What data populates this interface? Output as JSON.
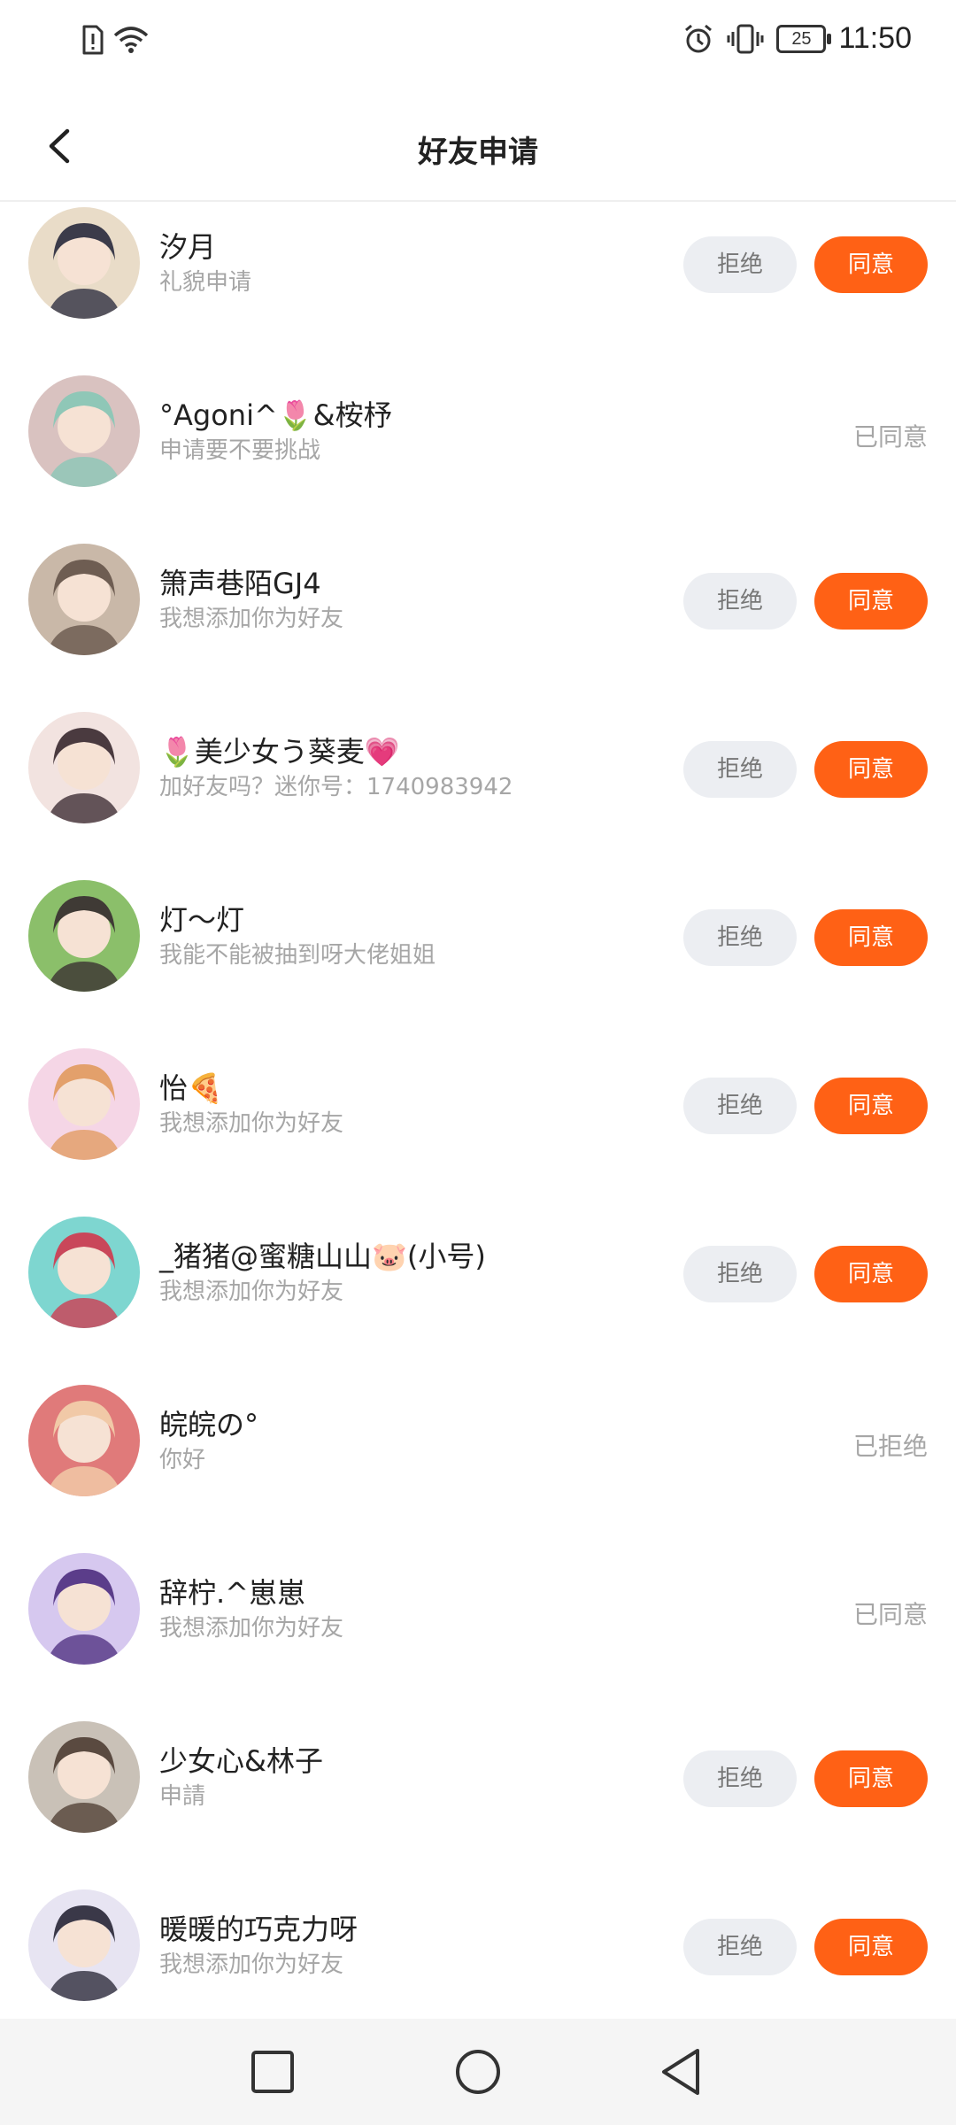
{
  "status_bar": {
    "time": "11:50",
    "battery": "25"
  },
  "header": {
    "title": "好友申请"
  },
  "buttons": {
    "reject": "拒绝",
    "accept": "同意"
  },
  "requests": [
    {
      "name": "汐月",
      "message": "礼貌申请",
      "status": "pending",
      "status_text": "",
      "avatar_colors": [
        "#e9dcc8",
        "#3b3b4a"
      ]
    },
    {
      "name": "°Agoni^🌷&桉杼",
      "message": "申请要不要挑战",
      "status": "accepted",
      "status_text": "已同意",
      "avatar_colors": [
        "#d9c2c0",
        "#8fc7b7"
      ]
    },
    {
      "name": "箫声巷陌GJ4",
      "message": "我想添加你为好友",
      "status": "pending",
      "status_text": "",
      "avatar_colors": [
        "#c9b8a8",
        "#6e5d52"
      ]
    },
    {
      "name": "🌷美少女う葵麦💗",
      "message": "加好友吗？迷你号：1740983942",
      "status": "pending",
      "status_text": "",
      "avatar_colors": [
        "#f2e3e0",
        "#4a3a3f"
      ]
    },
    {
      "name": "灯～灯",
      "message": "我能不能被抽到呀大佬姐姐",
      "status": "pending",
      "status_text": "",
      "avatar_colors": [
        "#8bbf6a",
        "#3f3a35"
      ]
    },
    {
      "name": "怡🍕",
      "message": "我想添加你为好友",
      "status": "pending",
      "status_text": "",
      "avatar_colors": [
        "#f5d6e6",
        "#e3a06b"
      ]
    },
    {
      "name": "_猪猪@蜜糖山山🐷(小号)",
      "message": "我想添加你为好友",
      "status": "pending",
      "status_text": "",
      "avatar_colors": [
        "#7ed6d0",
        "#c9475a"
      ]
    },
    {
      "name": "皖皖の°",
      "message": "你好",
      "status": "rejected",
      "status_text": "已拒绝",
      "avatar_colors": [
        "#e07a7a",
        "#f1c9a7"
      ]
    },
    {
      "name": "辞柠.^崽崽",
      "message": "我想添加你为好友",
      "status": "accepted",
      "status_text": "已同意",
      "avatar_colors": [
        "#d6c8ef",
        "#5b3d8a"
      ]
    },
    {
      "name": "少女心&林子",
      "message": "申請",
      "status": "pending",
      "status_text": "",
      "avatar_colors": [
        "#c9c1b7",
        "#5a4a40"
      ]
    },
    {
      "name": "暖暖的巧克力呀",
      "message": "我想添加你为好友",
      "status": "pending",
      "status_text": "",
      "avatar_colors": [
        "#e7e4f2",
        "#3a3848"
      ]
    }
  ],
  "nav_bar": {
    "icons": [
      "recent-apps-icon",
      "home-icon",
      "back-icon"
    ]
  }
}
